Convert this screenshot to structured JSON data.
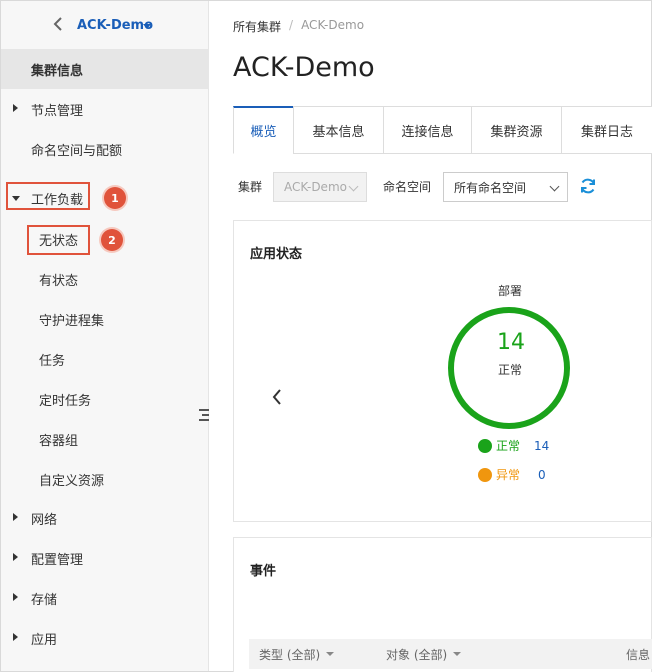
{
  "sidebar": {
    "cluster_name": "ACK-Demo",
    "items": [
      {
        "label": "集群信息"
      },
      {
        "label": "节点管理"
      },
      {
        "label": "命名空间与配额"
      },
      {
        "label": "工作负载"
      },
      {
        "label": "无状态"
      },
      {
        "label": "有状态"
      },
      {
        "label": "守护进程集"
      },
      {
        "label": "任务"
      },
      {
        "label": "定时任务"
      },
      {
        "label": "容器组"
      },
      {
        "label": "自定义资源"
      },
      {
        "label": "网络"
      },
      {
        "label": "配置管理"
      },
      {
        "label": "存储"
      },
      {
        "label": "应用"
      }
    ],
    "callouts": [
      "1",
      "2"
    ]
  },
  "breadcrumb": {
    "root": "所有集群",
    "separator": "/",
    "current": "ACK-Demo"
  },
  "page_title": "ACK-Demo",
  "tabs": [
    {
      "label": "概览"
    },
    {
      "label": "基本信息"
    },
    {
      "label": "连接信息"
    },
    {
      "label": "集群资源"
    },
    {
      "label": "集群日志"
    }
  ],
  "filters": {
    "cluster_label": "集群",
    "cluster_value": "ACK-Demo",
    "namespace_label": "命名空间",
    "namespace_value": "所有命名空间"
  },
  "app_status": {
    "title": "应用状态",
    "ring_title": "部署",
    "count": "14",
    "status": "正常",
    "legend": [
      {
        "label": "正常",
        "value": "14",
        "color": "#1aa31a"
      },
      {
        "label": "异常",
        "value": "0",
        "color": "#f0960e"
      }
    ]
  },
  "events": {
    "title": "事件",
    "columns": [
      {
        "label": "类型 (全部)"
      },
      {
        "label": "对象 (全部)"
      },
      {
        "label": "信息"
      }
    ]
  },
  "colors": {
    "accent": "#1a5eb8",
    "callout": "#e0533b",
    "ok": "#1aa31a"
  }
}
